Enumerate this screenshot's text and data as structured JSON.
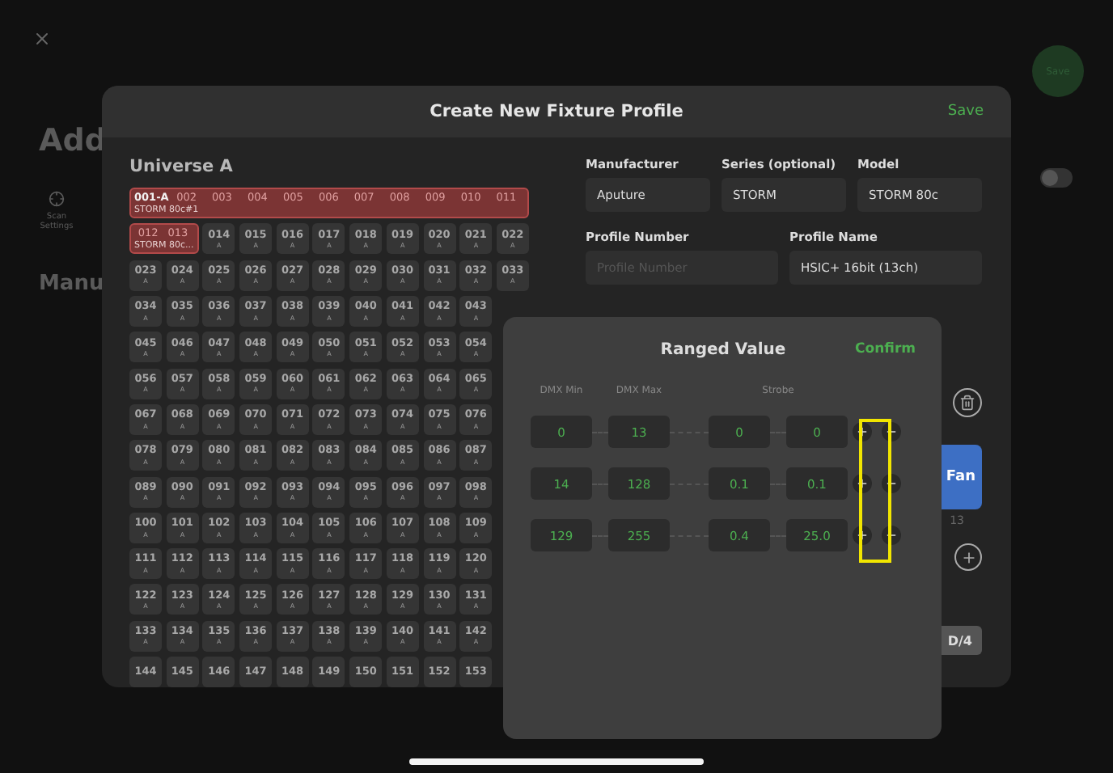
{
  "background": {
    "title": "Add",
    "save": "Save",
    "scan_settings": "Scan Settings",
    "section_title": "Manu",
    "toggle_on": false
  },
  "profile_dialog": {
    "title": "Create New Fixture Profile",
    "save": "Save",
    "universe": "Universe A",
    "rows": [
      {
        "fixture": {
          "first_is_address": true,
          "subtitle": "STORM 80c#1"
        },
        "cells": [
          [
            "001-A"
          ],
          [
            "002"
          ],
          [
            "003"
          ],
          [
            "004"
          ],
          [
            "005"
          ],
          [
            "006"
          ],
          [
            "007"
          ],
          [
            "008"
          ],
          [
            "009"
          ],
          [
            "010"
          ],
          [
            "011"
          ]
        ]
      },
      {
        "fixture": {
          "first_is_address": false,
          "subtitle": "STORM 80c..."
        },
        "cells": [
          [
            "012"
          ],
          [
            "013"
          ],
          [
            "014",
            "A"
          ],
          [
            "015",
            "A"
          ],
          [
            "016",
            "A"
          ],
          [
            "017",
            "A"
          ],
          [
            "018",
            "A"
          ],
          [
            "019",
            "A"
          ],
          [
            "020",
            "A"
          ],
          [
            "021",
            "A"
          ],
          [
            "022",
            "A"
          ]
        ]
      },
      {
        "cells": [
          [
            "023",
            "A"
          ],
          [
            "024",
            "A"
          ],
          [
            "025",
            "A"
          ],
          [
            "026",
            "A"
          ],
          [
            "027",
            "A"
          ],
          [
            "028",
            "A"
          ],
          [
            "029",
            "A"
          ],
          [
            "030",
            "A"
          ],
          [
            "031",
            "A"
          ],
          [
            "032",
            "A"
          ],
          [
            "033",
            "A"
          ]
        ]
      },
      {
        "cells": [
          [
            "034",
            "A"
          ],
          [
            "035",
            "A"
          ],
          [
            "036",
            "A"
          ],
          [
            "037",
            "A"
          ],
          [
            "038",
            "A"
          ],
          [
            "039",
            "A"
          ],
          [
            "040",
            "A"
          ],
          [
            "041",
            "A"
          ],
          [
            "042",
            "A"
          ],
          [
            "043",
            "A"
          ]
        ]
      },
      {
        "cells": [
          [
            "045",
            "A"
          ],
          [
            "046",
            "A"
          ],
          [
            "047",
            "A"
          ],
          [
            "048",
            "A"
          ],
          [
            "049",
            "A"
          ],
          [
            "050",
            "A"
          ],
          [
            "051",
            "A"
          ],
          [
            "052",
            "A"
          ],
          [
            "053",
            "A"
          ],
          [
            "054",
            "A"
          ]
        ]
      },
      {
        "cells": [
          [
            "056",
            "A"
          ],
          [
            "057",
            "A"
          ],
          [
            "058",
            "A"
          ],
          [
            "059",
            "A"
          ],
          [
            "060",
            "A"
          ],
          [
            "061",
            "A"
          ],
          [
            "062",
            "A"
          ],
          [
            "063",
            "A"
          ],
          [
            "064",
            "A"
          ],
          [
            "065",
            "A"
          ]
        ]
      },
      {
        "cells": [
          [
            "067",
            "A"
          ],
          [
            "068",
            "A"
          ],
          [
            "069",
            "A"
          ],
          [
            "070",
            "A"
          ],
          [
            "071",
            "A"
          ],
          [
            "072",
            "A"
          ],
          [
            "073",
            "A"
          ],
          [
            "074",
            "A"
          ],
          [
            "075",
            "A"
          ],
          [
            "076",
            "A"
          ]
        ]
      },
      {
        "cells": [
          [
            "078",
            "A"
          ],
          [
            "079",
            "A"
          ],
          [
            "080",
            "A"
          ],
          [
            "081",
            "A"
          ],
          [
            "082",
            "A"
          ],
          [
            "083",
            "A"
          ],
          [
            "084",
            "A"
          ],
          [
            "085",
            "A"
          ],
          [
            "086",
            "A"
          ],
          [
            "087",
            "A"
          ]
        ]
      },
      {
        "cells": [
          [
            "089",
            "A"
          ],
          [
            "090",
            "A"
          ],
          [
            "091",
            "A"
          ],
          [
            "092",
            "A"
          ],
          [
            "093",
            "A"
          ],
          [
            "094",
            "A"
          ],
          [
            "095",
            "A"
          ],
          [
            "096",
            "A"
          ],
          [
            "097",
            "A"
          ],
          [
            "098",
            "A"
          ]
        ]
      },
      {
        "cells": [
          [
            "100",
            "A"
          ],
          [
            "101",
            "A"
          ],
          [
            "102",
            "A"
          ],
          [
            "103",
            "A"
          ],
          [
            "104",
            "A"
          ],
          [
            "105",
            "A"
          ],
          [
            "106",
            "A"
          ],
          [
            "107",
            "A"
          ],
          [
            "108",
            "A"
          ],
          [
            "109",
            "A"
          ]
        ]
      },
      {
        "cells": [
          [
            "111",
            "A"
          ],
          [
            "112",
            "A"
          ],
          [
            "113",
            "A"
          ],
          [
            "114",
            "A"
          ],
          [
            "115",
            "A"
          ],
          [
            "116",
            "A"
          ],
          [
            "117",
            "A"
          ],
          [
            "118",
            "A"
          ],
          [
            "119",
            "A"
          ],
          [
            "120",
            "A"
          ]
        ]
      },
      {
        "cells": [
          [
            "122",
            "A"
          ],
          [
            "123",
            "A"
          ],
          [
            "124",
            "A"
          ],
          [
            "125",
            "A"
          ],
          [
            "126",
            "A"
          ],
          [
            "127",
            "A"
          ],
          [
            "128",
            "A"
          ],
          [
            "129",
            "A"
          ],
          [
            "130",
            "A"
          ],
          [
            "131",
            "A"
          ]
        ]
      },
      {
        "cells": [
          [
            "133",
            "A"
          ],
          [
            "134",
            "A"
          ],
          [
            "135",
            "A"
          ],
          [
            "136",
            "A"
          ],
          [
            "137",
            "A"
          ],
          [
            "138",
            "A"
          ],
          [
            "139",
            "A"
          ],
          [
            "140",
            "A"
          ],
          [
            "141",
            "A"
          ],
          [
            "142",
            "A"
          ]
        ]
      },
      {
        "cells": [
          [
            "144"
          ],
          [
            "145"
          ],
          [
            "146"
          ],
          [
            "147"
          ],
          [
            "148"
          ],
          [
            "149"
          ],
          [
            "150"
          ],
          [
            "151"
          ],
          [
            "152"
          ],
          [
            "153"
          ]
        ]
      }
    ],
    "fields_row_1": [
      {
        "label": "Manufacturer",
        "value": "Aputure"
      },
      {
        "label": "Series (optional)",
        "value": "STORM"
      },
      {
        "label": "Model",
        "value": "STORM 80c"
      }
    ],
    "fields_row_2": [
      {
        "label": "Profile Number",
        "placeholder": "Profile Number"
      },
      {
        "label": "Profile Name",
        "value": "HSIC+ 16bit (13ch)"
      }
    ],
    "side": {
      "fan_button": "Fan",
      "count": "13",
      "bottom_button": "D/4"
    }
  },
  "ranged_dialog": {
    "title": "Ranged Value",
    "confirm": "Confirm",
    "columns": [
      "DMX Min",
      "DMX Max",
      "Strobe"
    ],
    "rows": [
      {
        "dmx_min": "0",
        "dmx_max": "13",
        "strobe_from": "0",
        "strobe_to": "0"
      },
      {
        "dmx_min": "14",
        "dmx_max": "128",
        "strobe_from": "0.1",
        "strobe_to": "0.1"
      },
      {
        "dmx_min": "129",
        "dmx_max": "255",
        "strobe_from": "0.4",
        "strobe_to": "25.0"
      }
    ],
    "highlight_add_buttons": true
  }
}
